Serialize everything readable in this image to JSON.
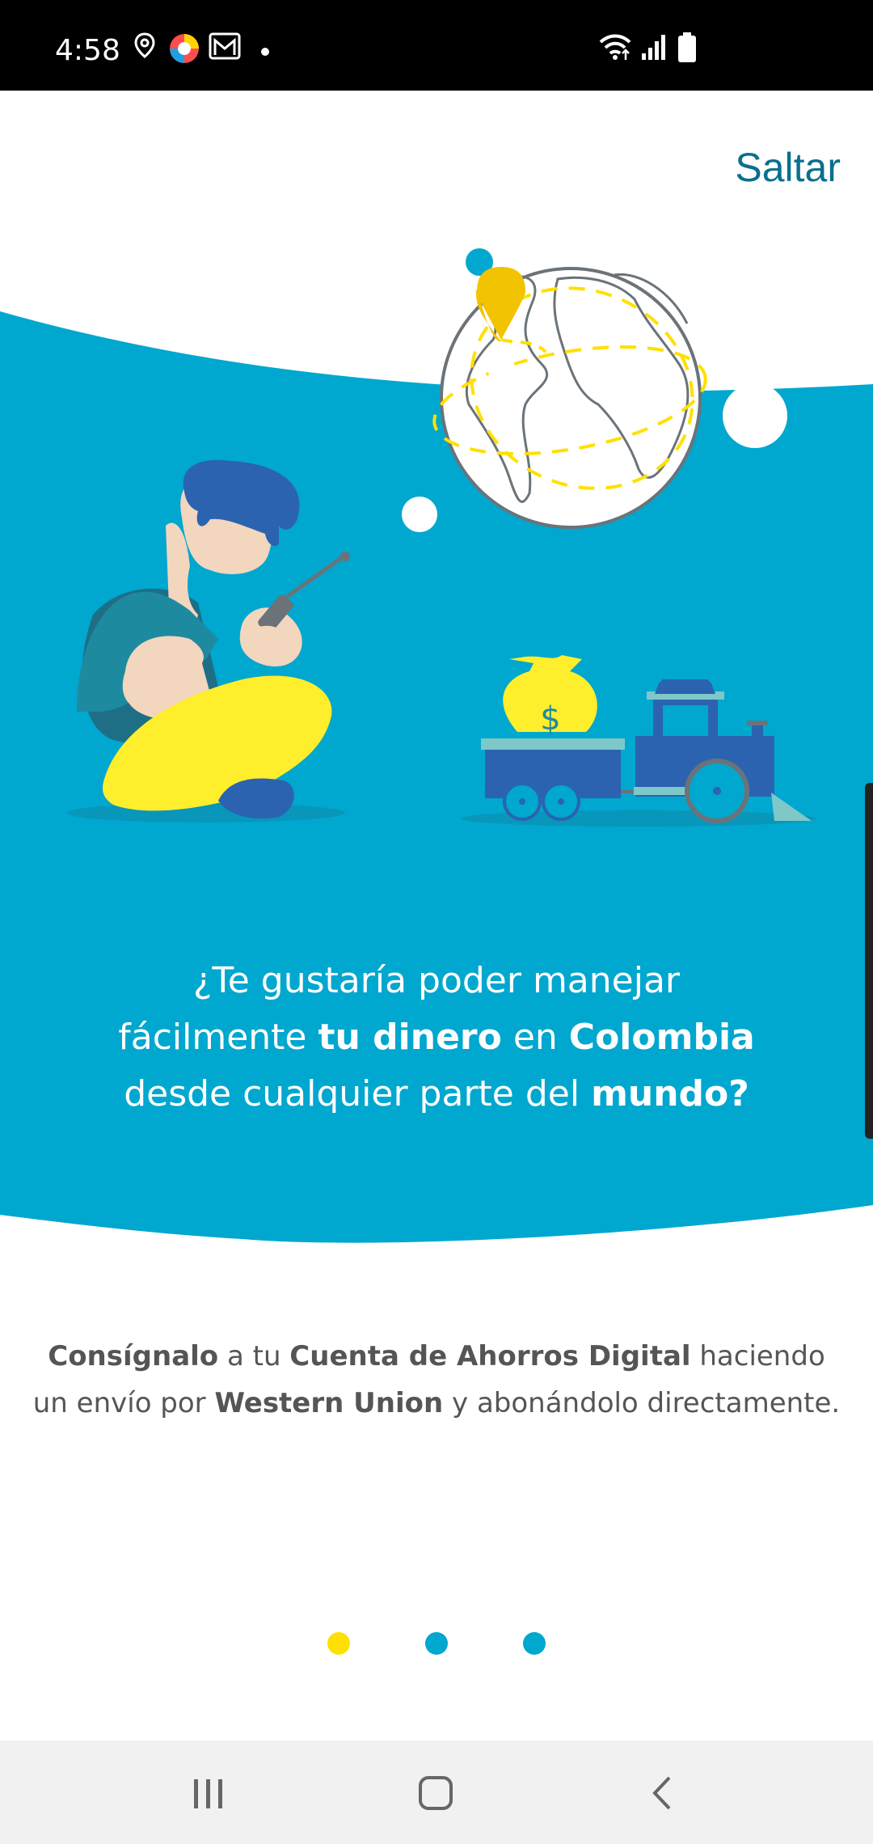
{
  "status_bar": {
    "time": "4:58",
    "left_icons": [
      "location-pin-icon",
      "browser-app-icon",
      "gmail-icon",
      "notification-dot-icon"
    ],
    "right_icons": [
      "wifi-icon",
      "signal-icon",
      "battery-icon"
    ]
  },
  "skip_label": "Saltar",
  "headline": {
    "line1": "¿Te gustaría poder manejar",
    "line2_pre": "fácilmente ",
    "line2_bold1": "tu dinero",
    "line2_mid": " en ",
    "line2_bold2": "Colombia",
    "line3_pre": "desde cualquier parte del ",
    "line3_bold": "mundo?"
  },
  "description": {
    "bold1": "Consígnalo",
    "text1": " a tu ",
    "bold2": "Cuenta de Ahorros Digital",
    "text2": " haciendo",
    "text3": "un envío por ",
    "bold3": "Western Union",
    "text4": " y abonándolo directamente."
  },
  "pagination": {
    "total": 3,
    "active": 1
  },
  "colors": {
    "accent_blue": "#00a7cf",
    "yellow": "#ffe000",
    "skip_text": "#0a6f8f",
    "body_text": "#555555"
  },
  "nav_bar": {
    "buttons": [
      "recent-apps-icon",
      "home-icon",
      "back-icon"
    ]
  }
}
